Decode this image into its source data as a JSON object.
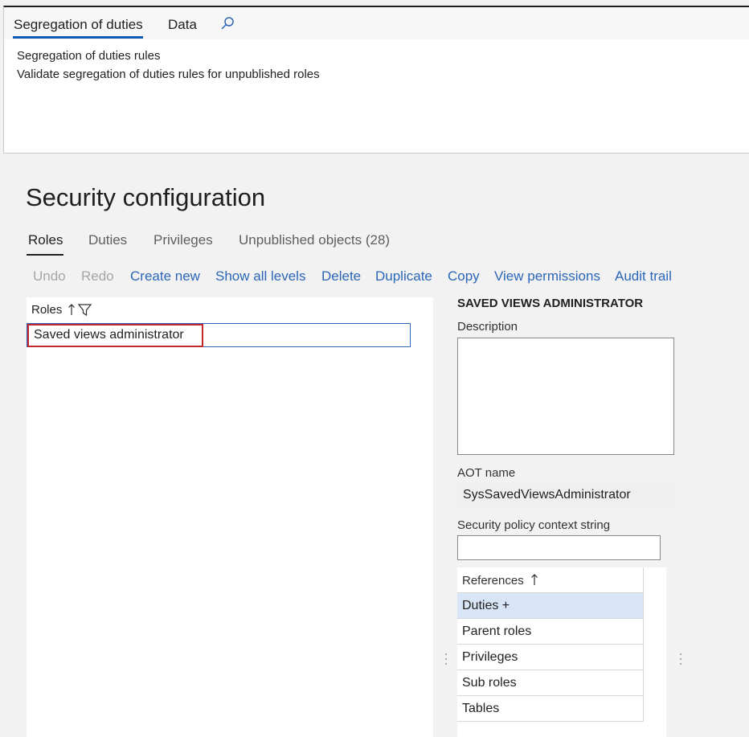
{
  "action_pane": {
    "tabs": [
      {
        "label": "Segregation of duties"
      },
      {
        "label": "Data"
      }
    ],
    "search_icon": "search-icon",
    "actions": [
      {
        "label": "Segregation of duties rules"
      },
      {
        "label": "Validate segregation of duties rules for unpublished roles"
      }
    ]
  },
  "page": {
    "title": "Security configuration"
  },
  "pivot": {
    "tabs": [
      {
        "label": "Roles"
      },
      {
        "label": "Duties"
      },
      {
        "label": "Privileges"
      },
      {
        "label": "Unpublished objects (28)"
      }
    ]
  },
  "toolbar": {
    "undo": "Undo",
    "redo": "Redo",
    "create_new": "Create new",
    "show_all_levels": "Show all levels",
    "delete": "Delete",
    "duplicate": "Duplicate",
    "copy": "Copy",
    "view_permissions": "View permissions",
    "audit_trail": "Audit trail"
  },
  "roles_grid": {
    "header": "Roles",
    "sort_icon": "sort-ascending-icon",
    "filter_icon": "filter-icon",
    "rows": [
      {
        "name": "Saved views administrator"
      }
    ]
  },
  "detail": {
    "title": "SAVED VIEWS ADMINISTRATOR",
    "description_label": "Description",
    "description_value": "",
    "aot_name_label": "AOT name",
    "aot_name_value": "SysSavedViewsAdministrator",
    "policy_label": "Security policy context string",
    "policy_value": "",
    "references": {
      "header": "References",
      "sort_icon": "sort-ascending-icon",
      "items": [
        {
          "label": "Duties +"
        },
        {
          "label": "Parent roles"
        },
        {
          "label": "Privileges"
        },
        {
          "label": "Sub roles"
        },
        {
          "label": "Tables"
        }
      ],
      "selected_index": 0
    }
  },
  "colors": {
    "link": "#2b66b8",
    "highlight_border": "#c1272d",
    "selected_row": "#d7e5f7",
    "tab_underline": "#0f5ab4"
  }
}
